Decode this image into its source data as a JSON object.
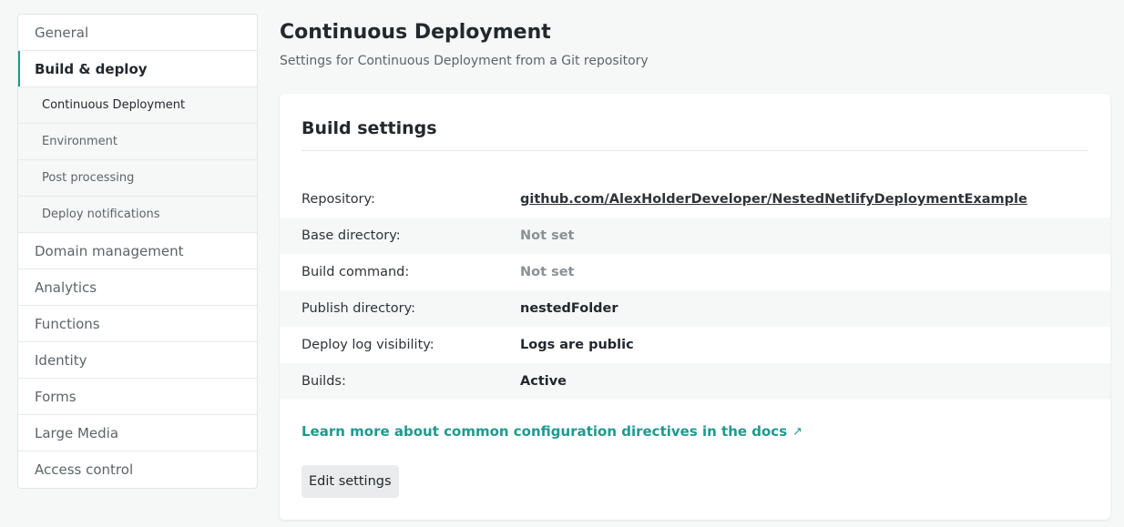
{
  "sidebar": {
    "items": [
      {
        "label": "General"
      },
      {
        "label": "Build & deploy"
      },
      {
        "label": "Domain management"
      },
      {
        "label": "Analytics"
      },
      {
        "label": "Functions"
      },
      {
        "label": "Identity"
      },
      {
        "label": "Forms"
      },
      {
        "label": "Large Media"
      },
      {
        "label": "Access control"
      }
    ],
    "subitems": [
      {
        "label": "Continuous Deployment"
      },
      {
        "label": "Environment"
      },
      {
        "label": "Post processing"
      },
      {
        "label": "Deploy notifications"
      }
    ],
    "active_section": "Build & deploy",
    "current_subitem": "Continuous Deployment"
  },
  "header": {
    "title": "Continuous Deployment",
    "subtitle": "Settings for Continuous Deployment from a Git repository"
  },
  "card": {
    "title": "Build settings",
    "rows": [
      {
        "label": "Repository:",
        "value": "github.com/AlexHolderDeveloper/NestedNetlifyDeploymentExample"
      },
      {
        "label": "Base directory:",
        "value": "Not set"
      },
      {
        "label": "Build command:",
        "value": "Not set"
      },
      {
        "label": "Publish directory:",
        "value": "nestedFolder"
      },
      {
        "label": "Deploy log visibility:",
        "value": "Logs are public"
      },
      {
        "label": "Builds:",
        "value": "Active"
      }
    ],
    "docs_link": "Learn more about common configuration directives in the docs",
    "docs_link_icon": "↗",
    "edit_button": "Edit settings"
  },
  "colors": {
    "accent": "#20998f",
    "background": "#f6f8f8",
    "muted_text": "#8a9196"
  }
}
